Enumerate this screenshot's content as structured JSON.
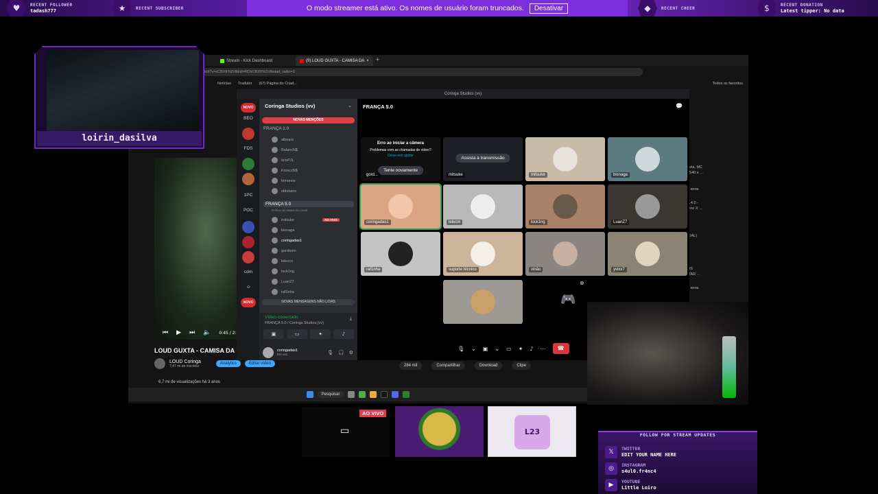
{
  "overlay": {
    "recent_follower_label": "RECENT FOLLOWER",
    "recent_follower": "tadash777",
    "recent_subscriber_label": "RECENT SUBSCRIBER",
    "streamer_message": "O modo streamer está ativo. Os nomes de usuário foram truncados.",
    "disable_button": "Desativar",
    "recent_cheer_label": "RECENT CHEER",
    "recent_donation_label": "RECENT DONATION",
    "latest_tipper": "Latest tipper: No data"
  },
  "webcam": {
    "streamer_name": "loirin_dasilva"
  },
  "browser": {
    "tab1": "Stream - Kick Dashboard",
    "tab2": "(9) LOUD GUXTA - CAMISA DA",
    "address": "atch?v=xCBXfr%2cfblist=RDxCBXfr%2cfbstart_radio=1",
    "bookmarks": [
      "Notícias",
      "Tradutor",
      "(67) Página do Criad..."
    ],
    "all_favorites": "Todos os favoritos"
  },
  "youtube": {
    "time": "0:45 / 2:",
    "title": "LOUD GUXTA - CAMISA DA I",
    "channel": "LOUD Coringa",
    "subscribers": "7,47 mi de inscritos",
    "analytics": "Analytics",
    "edit_video": "Editar vídeo",
    "views": "6,7 mi de visualizações  há 3 anos",
    "likes": "284 mil",
    "share": "Compartilhar",
    "download": "Download",
    "clip": "Clipe",
    "rec": [
      "uxta, MC",
      "8540 e ...",
      "3 anos",
      "A 4.0 -",
      "mnz X ...",
      "CIAL)",
      "OS",
      "ITAR ...",
      "4 anos"
    ]
  },
  "taskbar": {
    "search": "Pesquisar"
  },
  "discord": {
    "window_title": "Coringa Studios (vv)",
    "server_name": "Coringa Studios (vv)",
    "novas_mencoes": "NOVAS MENÇÕES",
    "novas_mensagens": "NOVAS MENSAGENS NÃO LIDAS",
    "servers": [
      "NOVO",
      "BEO",
      "FDS",
      "1PC",
      "POC",
      "cdm",
      "o",
      "NOVO"
    ],
    "channel1": "FRANÇA 1.0",
    "channel1_members": [
      "albears",
      "BalancN$",
      "tersPJL",
      "KrosccN$",
      "lemonns",
      "oldokaos"
    ],
    "channel2": "FRANÇA 5.0",
    "channel2_status": "Defina um status do canal",
    "ao_vivo": "AO VIVO",
    "channel2_members": [
      "mitsuke",
      "bisnaga",
      "coringadas1",
      "gordoom",
      "lelecco",
      "lock1ng",
      "LuanZ7",
      "raf1nha"
    ],
    "video_connected": "Vídeo conectado",
    "voice_location": "FRANÇA 5.0 / Coringa Studios (vv)",
    "user_name": "coringadas1",
    "user_status": "Em voz",
    "stage_title": "FRANÇA 5.0",
    "camera_error_title": "Erro ao iniciar a câmera",
    "camera_error_text": "Problemas com as chamadas de vídeo?",
    "camera_error_link": "Deixe-nos ajudar",
    "retry": "Tente novamente",
    "watch_stream": "Assista à transmissão",
    "tiles": [
      "gord...",
      "mitsuke",
      "mitsuke",
      "bisnaga",
      "coringadas1",
      "lelecm",
      "lock1ng",
      "LuanZ7",
      "raf1nha",
      "suporte técnico",
      "vinão",
      "yvixx7"
    ]
  },
  "bottom": {
    "ao_vivo": "AO VIVO",
    "brand_mark": "L23"
  },
  "follow_panel": {
    "header": "FOLLOW FOR STREAM UPDATES",
    "twitter_label": "TWITTER",
    "twitter": "EDIT YOUR NAME HERE",
    "instagram_label": "INSTAGRAM",
    "instagram": "s4ul0.fr4nc4",
    "youtube_label": "YOUTUBE",
    "youtube": "Little Loiro"
  },
  "colors": {
    "accent_purple": "#7b2cd8",
    "discord_red": "#e23d4a",
    "voice_green": "#23a55a"
  }
}
